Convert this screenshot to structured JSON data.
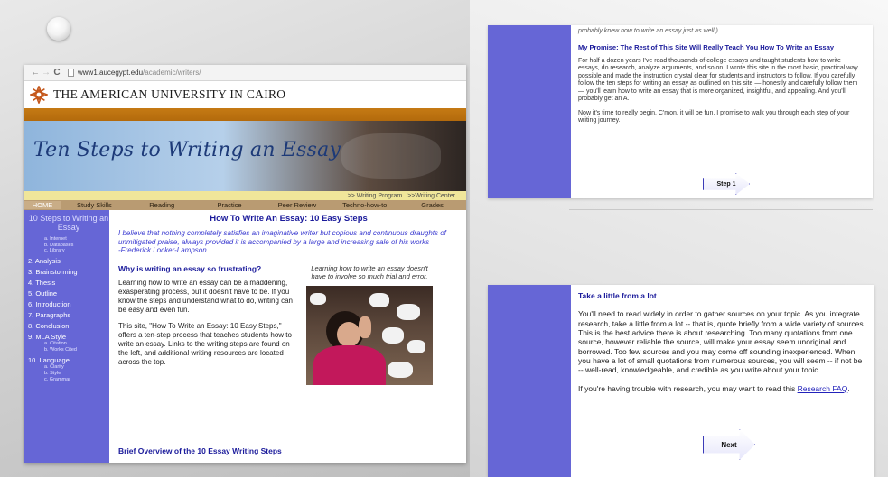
{
  "browser": {
    "url_host": "www1.aucegypt.edu",
    "url_path": "/academic/writers/",
    "institution": "THE AMERICAN UNIVERSITY IN CAIRO",
    "banner_title": "Ten Steps to Writing an Essay",
    "program_links": [
      ">> Writing Program",
      ">>Writing Center"
    ],
    "menu": [
      "HOME",
      "Study Skills",
      "Reading",
      "Practice",
      "Peer Review",
      "Techno-how-to",
      "Grades"
    ]
  },
  "sidebar": {
    "title": "10 Steps to Writing an Essay",
    "items": [
      {
        "label": "",
        "subs": [
          "a. Internet",
          "b. Databases",
          "c. Library"
        ]
      },
      {
        "label": "2. Analysis",
        "subs": []
      },
      {
        "label": "3. Brainstorming",
        "subs": []
      },
      {
        "label": "4. Thesis",
        "subs": []
      },
      {
        "label": "5. Outline",
        "subs": []
      },
      {
        "label": "6. Introduction",
        "subs": []
      },
      {
        "label": "7. Paragraphs",
        "subs": []
      },
      {
        "label": "8. Conclusion",
        "subs": []
      },
      {
        "label": "9. MLA Style",
        "subs": [
          "a. Citation",
          "b. Works Cited"
        ]
      },
      {
        "label": "10. Language",
        "subs": [
          "a. Clarity",
          "b. Style",
          "c. Grammar"
        ]
      }
    ]
  },
  "main": {
    "heading": "How To Write An Essay: 10 Easy Steps",
    "quote": "I believe that nothing completely satisfies an imaginative writer but copious and continuous draughts of unmitigated praise, always provided it is accompanied by a large and increasing sale of his works",
    "quote_author": "-Frederick Locker-Lampson",
    "subheading": "Why is writing an essay so frustrating?",
    "para1": "Learning how to write an essay can be a maddening, exasperating process, but it doesn't have to be. If you know the steps and understand what to do, writing can be easy and even fun.",
    "para2": "This site, \"How To Write an Essay: 10 Easy Steps,\" offers a ten-step process that teaches students how to write an essay. Links to the writing steps are found on the left, and additional writing resources are located across the top.",
    "caption": "Learning how to write an essay doesn't have to involve so much trial and error.",
    "brief": "Brief Overview of the 10 Essay Writing Steps"
  },
  "top_card": {
    "clip": "probably knew how to write an essay just as well.)",
    "heading": "My Promise: The Rest of This Site Will Really Teach You How To Write an Essay",
    "para1": "For half a dozen years I've read thousands of college essays and taught students how to write essays, do research, analyze arguments, and so on. I wrote this site in the most basic, practical way possible and made the instruction crystal clear for students and instructors to follow. If you carefully follow the ten steps for writing an essay as outlined on this site — honestly and carefully follow them — you'll learn how to write an essay that is more organized, insightful, and appealing. And you'll probably get an A.",
    "para2": "Now it's time to really begin. C'mon, it will be fun. I promise to walk you through each step of your writing journey.",
    "button": "Step 1"
  },
  "bottom_card": {
    "heading": "Take a little from a lot",
    "para1": "You'll need to read widely in order to gather sources on your topic. As you integrate research, take a little from a lot -- that is, quote briefly from a wide variety of sources. This is the best advice there is about researching. Too many quotations from one source, however reliable the source, will make your essay seem unoriginal and borrowed. Too few sources and you may come off sounding inexperienced. When you have a lot of small quotations from numerous sources, you will seem -- if not be -- well-read, knowledgeable, and credible as you write about your topic.",
    "para2_prefix": "If you're having trouble with research, you may want to read this ",
    "link": "Research FAQ",
    "para2_suffix": ".",
    "button": "Next"
  },
  "colors": {
    "sidebar": "#6666d6",
    "orange_bar": "#c57a14",
    "menu_bar": "#b99b72",
    "heading_blue": "#1a1a9b"
  }
}
